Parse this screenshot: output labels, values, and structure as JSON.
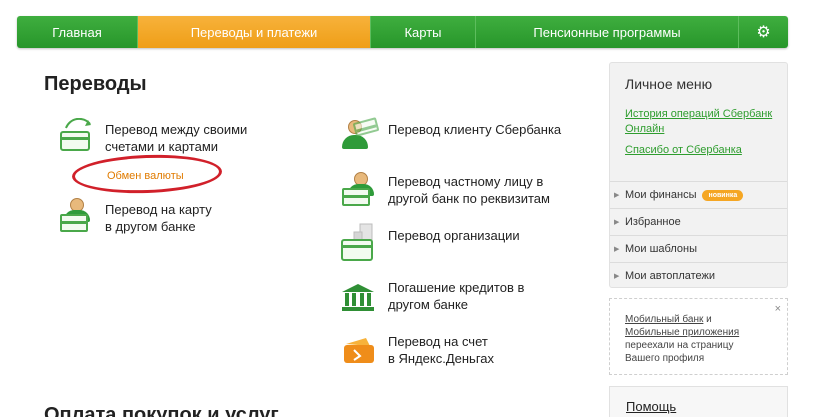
{
  "nav": {
    "items": [
      "Главная",
      "Переводы и платежи",
      "Карты",
      "Пенсионные программы"
    ],
    "active_index": 1,
    "settings_icon": "gear-icon"
  },
  "main": {
    "title": "Переводы",
    "links": [
      {
        "line1": "Перевод между своими",
        "line2": "счетами и картами",
        "icon": "card-exchange-icon"
      },
      {
        "line1": "Перевод на карту",
        "line2": "в другом банке",
        "icon": "person-card-icon"
      },
      {
        "line1": "Перевод клиенту Сбербанка",
        "line2": "",
        "icon": "person-card-icon"
      },
      {
        "line1": "Перевод частному лицу в",
        "line2": "другой банк по реквизитам",
        "icon": "person-card-icon"
      },
      {
        "line1": "Перевод организации",
        "line2": "",
        "icon": "building-card-icon"
      },
      {
        "line1": "Погашение кредитов в",
        "line2": "другом банке",
        "icon": "bank-icon"
      },
      {
        "line1": "Перевод на счет",
        "line2": "в Яндекс.Деньгах",
        "icon": "yandex-wallet-icon"
      }
    ],
    "exchange_link": "Обмен валюты",
    "next_section_title": "Оплата покупок и услуг"
  },
  "sidebar": {
    "title": "Личное меню",
    "links": [
      "История операций Сбербанк Онлайн",
      "Спасибо от Сбербанка"
    ],
    "rows": [
      "Мои финансы",
      "Избранное",
      "Мои шаблоны",
      "Мои автоплатежи"
    ],
    "badge": "новинка"
  },
  "note": {
    "link1": "Мобильный банк",
    "and": " и ",
    "link2": "Мобильные приложения",
    "rest": " переехали на страницу Вашего профиля",
    "close": "×"
  },
  "help": {
    "label": "Помощь"
  },
  "colors": {
    "accent_green": "#27962a",
    "active_orange": "#ef9e17",
    "highlight_red": "#d1202a"
  }
}
